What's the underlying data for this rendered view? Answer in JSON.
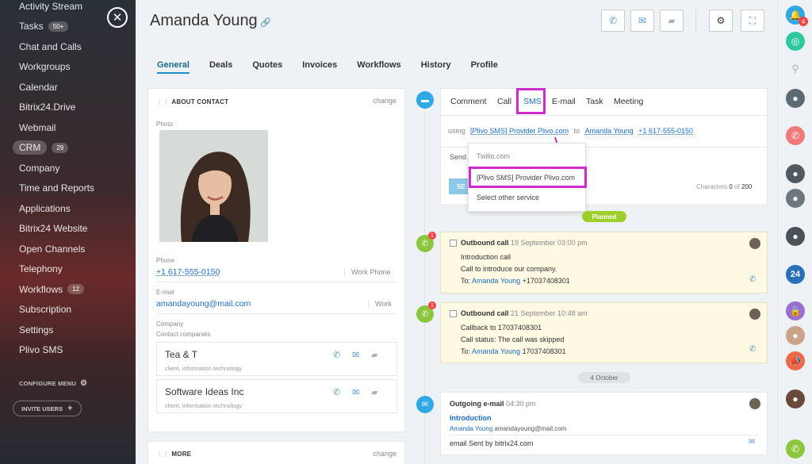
{
  "sidebar": {
    "items": [
      {
        "label": "Activity Stream",
        "count": ""
      },
      {
        "label": "Tasks",
        "count": "50+"
      },
      {
        "label": "Chat and Calls",
        "count": ""
      },
      {
        "label": "Workgroups",
        "count": ""
      },
      {
        "label": "Calendar",
        "count": ""
      },
      {
        "label": "Bitrix24.Drive",
        "count": ""
      },
      {
        "label": "Webmail",
        "count": ""
      },
      {
        "label": "CRM",
        "count": "29"
      },
      {
        "label": "Company",
        "count": ""
      },
      {
        "label": "Time and Reports",
        "count": ""
      },
      {
        "label": "Applications",
        "count": ""
      },
      {
        "label": "Bitrix24 Website",
        "count": ""
      },
      {
        "label": "Open Channels",
        "count": ""
      },
      {
        "label": "Telephony",
        "count": ""
      },
      {
        "label": "Workflows",
        "count": "12"
      },
      {
        "label": "Subscription",
        "count": ""
      },
      {
        "label": "Settings",
        "count": ""
      },
      {
        "label": "Plivo SMS",
        "count": ""
      }
    ],
    "configure_menu": "CONFIGURE MENU",
    "invite_users": "INVITE USERS",
    "close_symbol": "✕"
  },
  "header": {
    "name": "Amanda Young",
    "tabs": [
      "General",
      "Deals",
      "Quotes",
      "Invoices",
      "Workflows",
      "History",
      "Profile"
    ]
  },
  "about": {
    "title": "ABOUT CONTACT",
    "change": "change",
    "photo_label": "Photo",
    "phone_label": "Phone",
    "phone": "+1 617-555-0150",
    "phone_type": "Work Phone",
    "email_label": "E-mail",
    "email": "amandayoung@mail.com",
    "email_type": "Work",
    "company_label": "Company",
    "contact_companies_label": "Contact companies",
    "companies": [
      {
        "name": "Tea & T",
        "sub": "client, information technology"
      },
      {
        "name": "Software Ideas Inc",
        "sub": "client, information technology"
      }
    ]
  },
  "more": {
    "title": "MORE",
    "change": "change"
  },
  "editor": {
    "tabs": [
      "Comment",
      "Call",
      "SMS",
      "E-mail",
      "Task",
      "Meeting"
    ],
    "using_label": "using",
    "provider": "[Plivo SMS] Provider Plivo.com",
    "to_label": "to",
    "recipient": "Amanda Young",
    "recipient_phone": "+1 617-555-0150",
    "send_partial": "Send",
    "send_btn_partial": "SE",
    "characters_label": "Characters",
    "characters_count": "0",
    "of_label": "of",
    "characters_max": "200",
    "dropdown": [
      "Twilio.com",
      "[Plivo SMS] Provider Plivo.com",
      "Select other service"
    ]
  },
  "timeline": {
    "planned_label": "Planned",
    "date_label": "4 October",
    "activities": [
      {
        "type": "Outbound call",
        "time": "19 September 03:00 pm",
        "subject": "Introduction call",
        "desc": "Call to introduce our company.",
        "to_label": "To:",
        "to_name": "Amanda Young",
        "to_phone": "+17037408301",
        "badge": "1"
      },
      {
        "type": "Outbound call",
        "time": "21 September 10:48 am",
        "subject": "Callback to 17037408301",
        "desc": "Call status: The call was skipped",
        "to_label": "To:",
        "to_name": "Amanda Young",
        "to_phone": "17037408301",
        "badge": "1"
      }
    ],
    "email": {
      "type": "Outgoing e-mail",
      "time": "04:30 pm",
      "subject": "Introduction",
      "from_name": "Amanda Young",
      "from_email": "amandayoung@mail.com",
      "body": "email Sent by bitrix24.com"
    }
  },
  "rightbar": {
    "notif_count": "4",
    "badge_24": "24"
  },
  "colors": {
    "accent": "#1c8fc7",
    "highlight": "#d02ac8",
    "planned": "#9dcf2b",
    "call_icon": "#8cc63f",
    "link": "#1a6ec1"
  }
}
